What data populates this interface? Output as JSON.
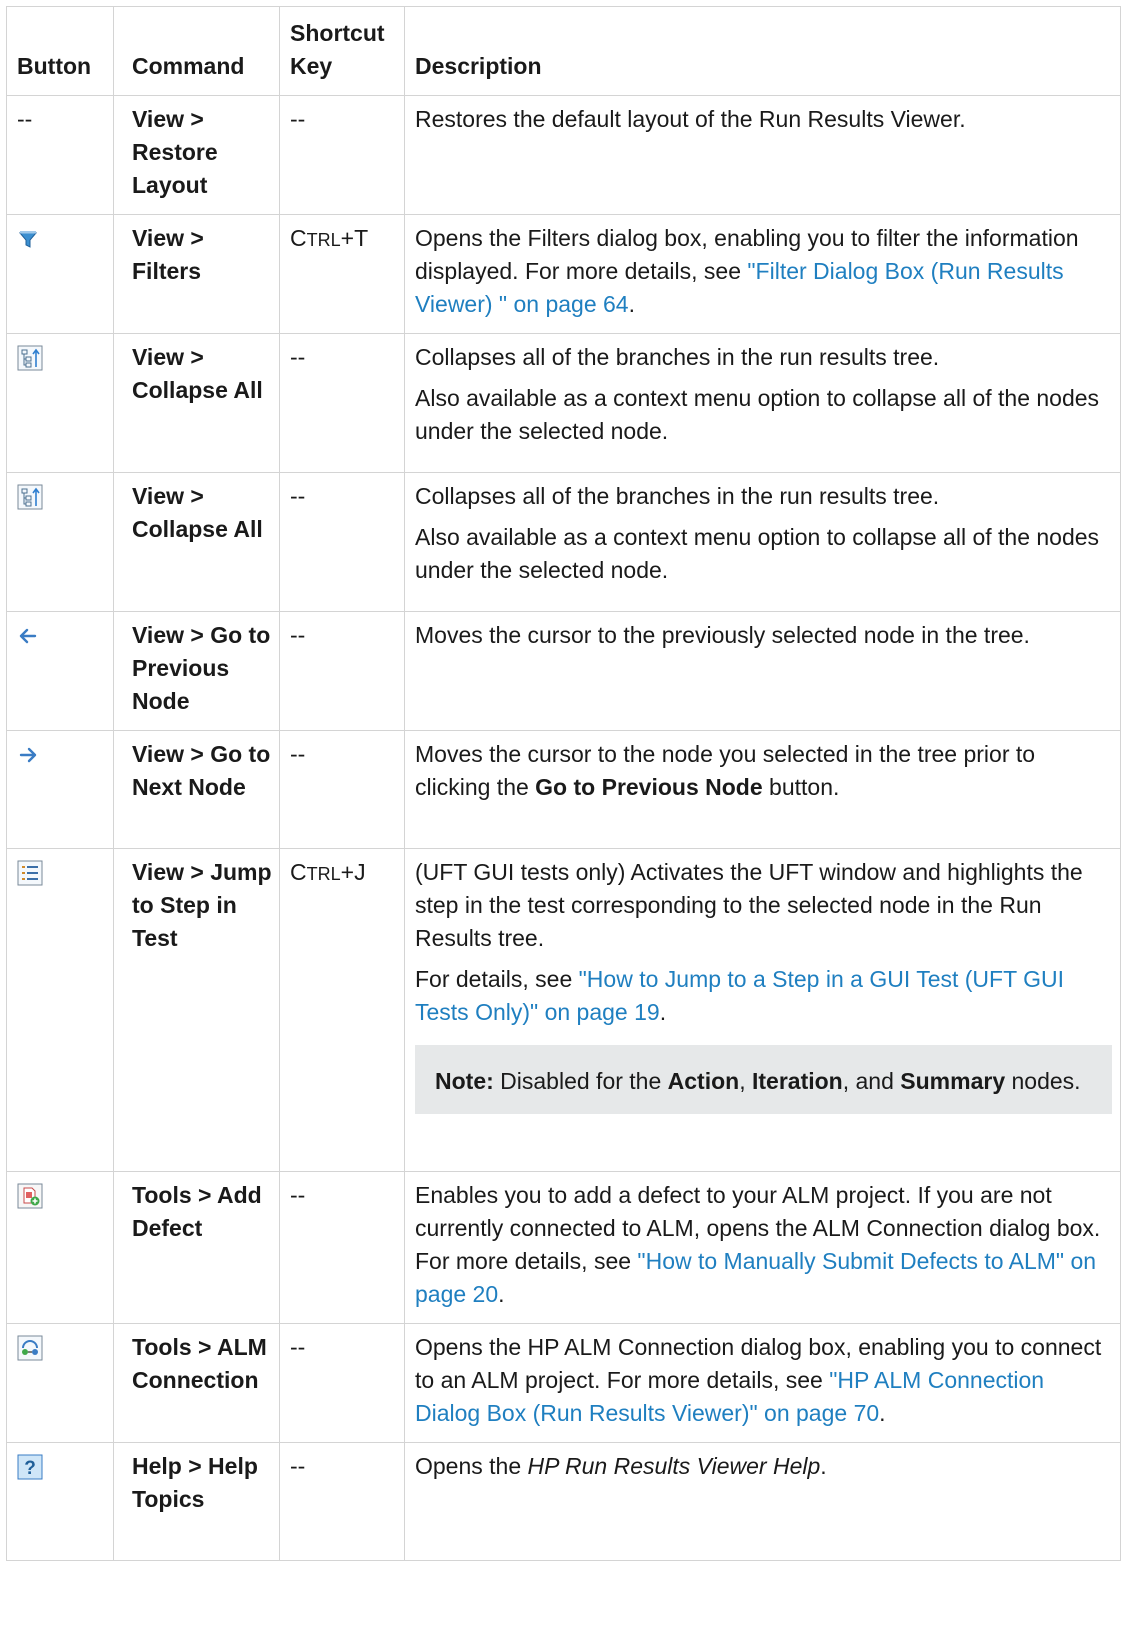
{
  "headers": {
    "button": "Button",
    "command_line1": "Command",
    "shortcut_line1": "Shortcut",
    "shortcut_line2": "Key",
    "description": "Description"
  },
  "rows": [
    {
      "button": "--",
      "command": "View > Restore Layout",
      "shortcut": "--",
      "desc": "Restores the default layout of the Run Results Viewer."
    },
    {
      "button_icon": "filter-icon",
      "command": "View > Filters",
      "shortcut_prefix": "C",
      "shortcut_small": "TRL",
      "shortcut_suffix": "+T",
      "desc_text": "Opens the Filters dialog box, enabling you to filter the information displayed. For more details, see ",
      "desc_link": "\"Filter Dialog Box (Run Results Viewer) \" on page 64",
      "desc_end": "."
    },
    {
      "button_icon": "collapse-all-icon",
      "command": "View > Collapse All",
      "shortcut": "--",
      "desc_p1": "Collapses all of the branches in the run results tree.",
      "desc_p2": "Also available as a context menu option to collapse all of the nodes under the selected node."
    },
    {
      "button_icon": "collapse-all-icon",
      "command": "View > Collapse All",
      "shortcut": "--",
      "desc_p1": "Collapses all of the branches in the run results tree.",
      "desc_p2": "Also available as a context menu option to collapse all of the nodes under the selected node."
    },
    {
      "button_icon": "arrow-left-icon",
      "command": "View > Go to Previous Node",
      "shortcut": "--",
      "desc": "Moves the cursor to the previously selected node in the tree."
    },
    {
      "button_icon": "arrow-right-icon",
      "command": "View > Go to Next Node",
      "shortcut": "--",
      "desc_pre": "Moves the cursor to the node you selected in the tree prior to clicking the ",
      "desc_bold": "Go to Previous Node",
      "desc_post": " button."
    },
    {
      "button_icon": "jump-to-step-icon",
      "command": "View > Jump to Step in Test",
      "shortcut_prefix": "C",
      "shortcut_small": "TRL",
      "shortcut_suffix": "+J",
      "desc_p1": "(UFT GUI tests only) Activates the UFT window and highlights the step in the test corresponding to the selected node in the Run Results tree.",
      "desc_p2_pre": "For details, see ",
      "desc_p2_link": "\"How to Jump to a Step in a GUI Test (UFT GUI Tests Only)\" on page 19",
      "desc_p2_end": ".",
      "note_label": "Note:",
      "note_pre": " Disabled for the ",
      "note_b1": "Action",
      "note_mid1": ", ",
      "note_b2": "Iteration",
      "note_mid2": ", and ",
      "note_b3": "Summary",
      "note_post": " nodes."
    },
    {
      "button_icon": "add-defect-icon",
      "command": "Tools > Add Defect",
      "shortcut": "--",
      "desc_text": "Enables you to add a defect to your ALM project. If you are not currently connected to ALM, opens the ALM Connection dialog box. For more details, see ",
      "desc_link": "\"How to Manually Submit Defects to ALM\" on page 20",
      "desc_end": "."
    },
    {
      "button_icon": "alm-connection-icon",
      "command": "Tools > ALM Connection",
      "shortcut": "--",
      "desc_text": "Opens the HP ALM Connection dialog box, enabling you to connect to an ALM project. For more details, see ",
      "desc_link": "\"HP ALM Connection Dialog Box (Run Results Viewer)\" on page 70",
      "desc_end": "."
    },
    {
      "button_icon": "help-icon",
      "command": "Help > Help Topics",
      "shortcut": "--",
      "desc_pre": "Opens the ",
      "desc_ital": "HP Run Results Viewer Help",
      "desc_post": "."
    }
  ]
}
